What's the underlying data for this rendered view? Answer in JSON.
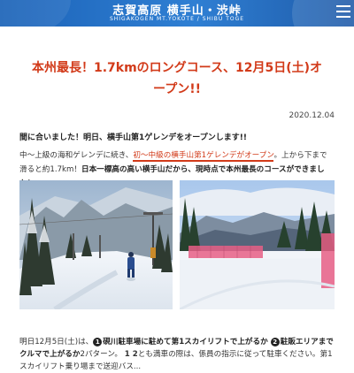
{
  "header": {
    "title": "志賀高原 横手山・渋峠",
    "subtitle": "SHIGAKOGEN  MT.YOKOTE / SHIBU TOGE"
  },
  "post": {
    "title": "本州最長！1.7kmのロングコース、12月5日(土)オープン!!",
    "date": "2020.12.04",
    "lead": "間に合いました！明日、横手山第1ゲレンデをオープンします!!",
    "para_1a": "中～上級の海和ゲレンデに続き、",
    "para_1b": "初～中級の横手山第1ゲレンデがオープン",
    "para_1c": "。上から下まで滑ると約1.7km！",
    "para_1d": "日本一標高の高い横手山だから、現時点で本州最長のコースができました！",
    "bottom_1": "明日12月5日(土)は、",
    "bottom_opt1_num": "1",
    "bottom_opt1": "硯川駐車場に駐めて第1スカイリフトで上がるか",
    "bottom_opt2_num": "2",
    "bottom_opt2": "駐販エリアまでクルマで上がるか",
    "bottom_2": "2パターン。",
    "bottom_nums": "1 2",
    "bottom_3": "とも満車の際は、係員の指示に従って駐車ください。第1スカイリフト乗り場まで送迎バス..."
  }
}
